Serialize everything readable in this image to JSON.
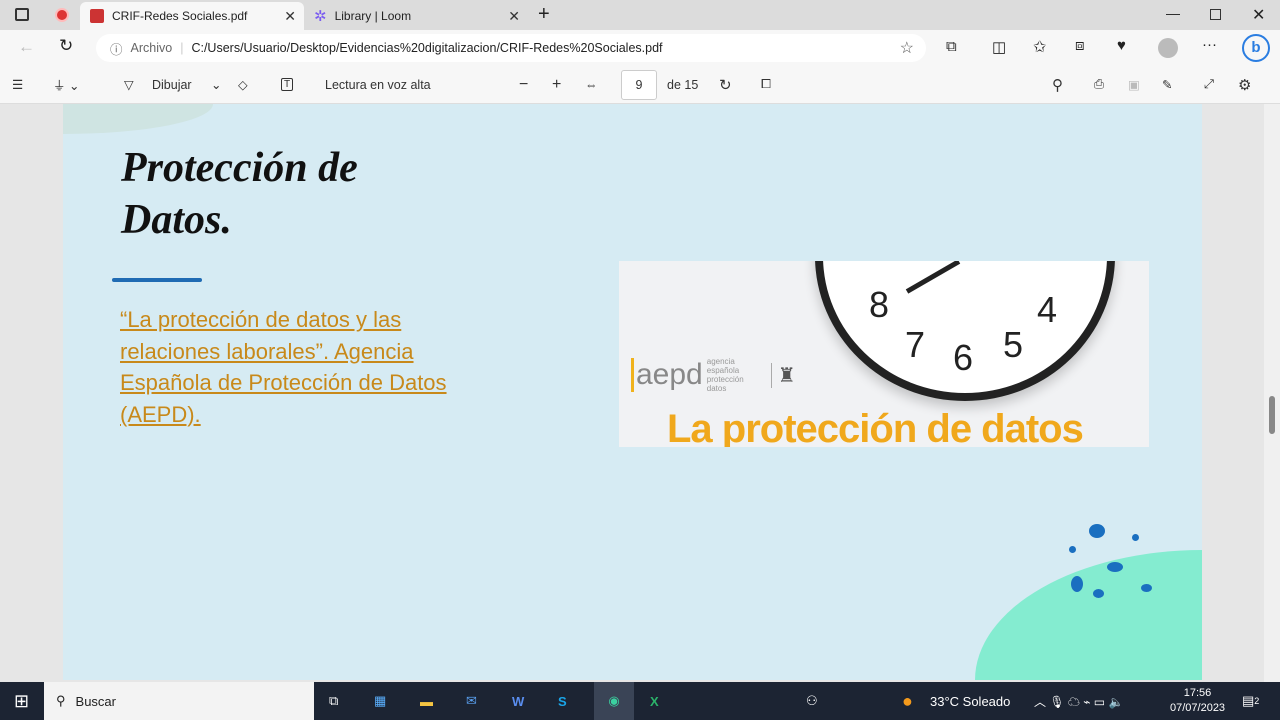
{
  "tabs": [
    {
      "label": "CRIF-Redes Sociales.pdf"
    },
    {
      "label": "Library | Loom"
    }
  ],
  "address": {
    "prefix": "Archivo",
    "url": "C:/Users/Usuario/Desktop/Evidencias%20digitalizacion/CRIF-Redes%20Sociales.pdf"
  },
  "pdf_toolbar": {
    "draw": "Dibujar",
    "read_aloud": "Lectura en voz alta",
    "page": "9",
    "of": "de 15"
  },
  "slide": {
    "title_line1": "Protección de",
    "title_line2": "Datos.",
    "link": "“La protección de datos y las relaciones laborales”. Agencia Española de Protección de Datos (AEPD).",
    "image": {
      "logo": "aepd",
      "logo_sub": [
        "agencia",
        "española",
        "protección",
        "datos"
      ],
      "headline": "La protección de datos",
      "clock_numbers": [
        "8",
        "7",
        "6",
        "5",
        "4"
      ]
    }
  },
  "taskbar": {
    "search": "Buscar",
    "weather": "33°C  Soleado",
    "time": "17:56",
    "date": "07/07/2023",
    "notifications": "2"
  },
  "colors": {
    "link": "#c8891a",
    "page_bg": "#d6ebf3",
    "accent_rule": "#1f6bb3"
  }
}
